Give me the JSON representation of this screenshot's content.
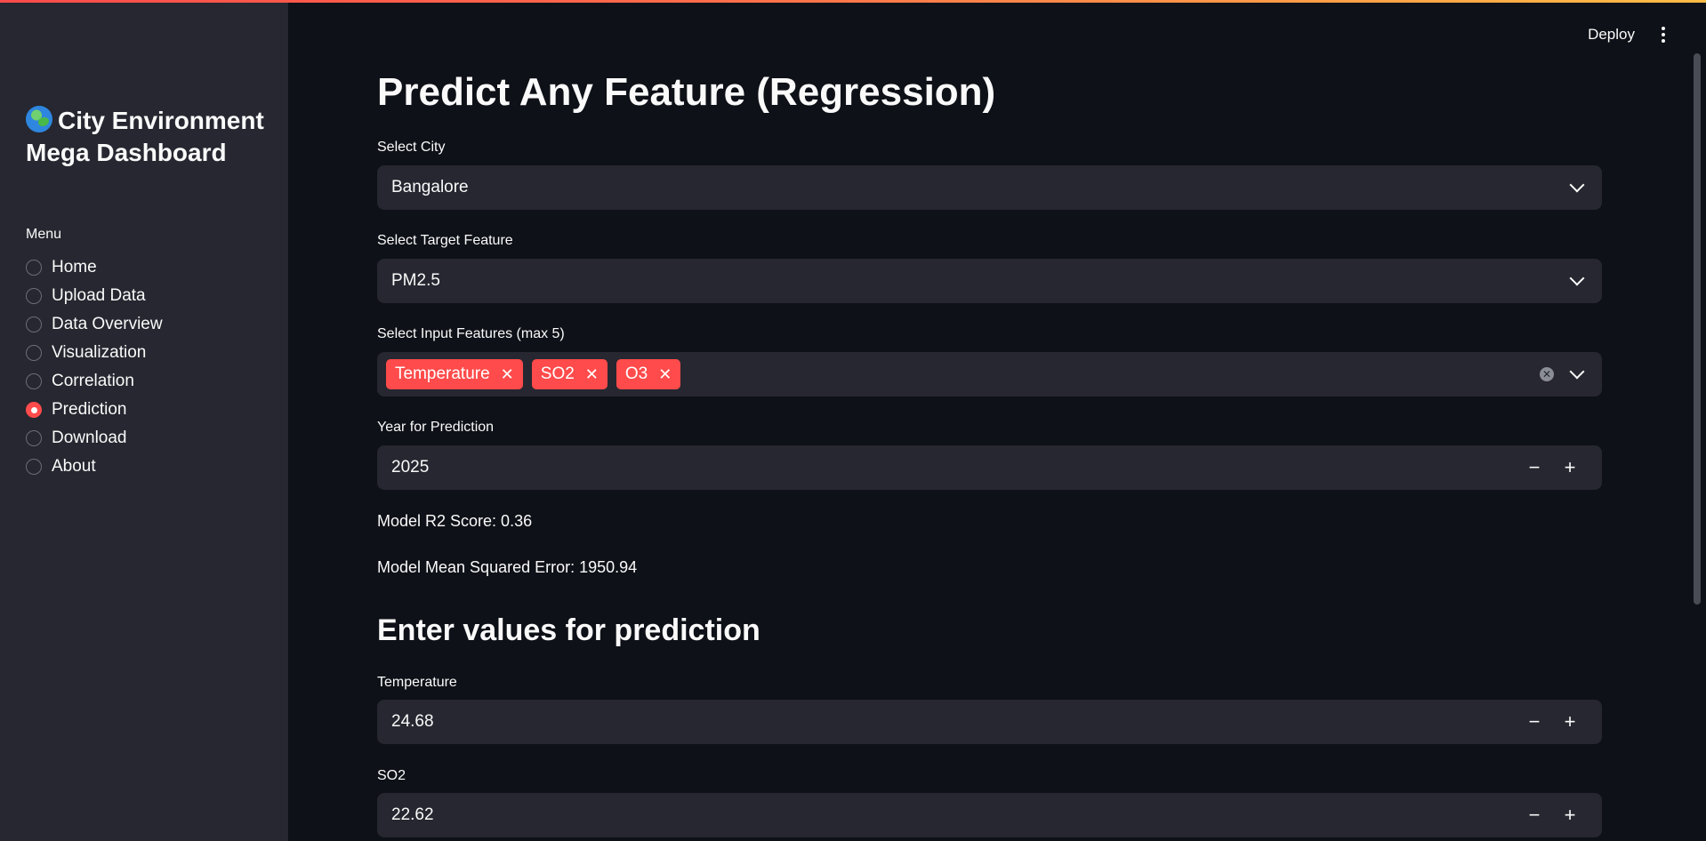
{
  "sidebar": {
    "title": "City Environment Mega Dashboard",
    "menu_label": "Menu",
    "items": [
      {
        "label": "Home",
        "selected": false
      },
      {
        "label": "Upload Data",
        "selected": false
      },
      {
        "label": "Data Overview",
        "selected": false
      },
      {
        "label": "Visualization",
        "selected": false
      },
      {
        "label": "Correlation",
        "selected": false
      },
      {
        "label": "Prediction",
        "selected": true
      },
      {
        "label": "Download",
        "selected": false
      },
      {
        "label": "About",
        "selected": false
      }
    ]
  },
  "header": {
    "deploy_label": "Deploy"
  },
  "main": {
    "title": "Predict Any Feature (Regression)",
    "city": {
      "label": "Select City",
      "value": "Bangalore"
    },
    "target": {
      "label": "Select Target Feature",
      "value": "PM2.5"
    },
    "inputs": {
      "label": "Select Input Features (max 5)",
      "tags": [
        "Temperature",
        "SO2",
        "O3"
      ]
    },
    "year": {
      "label": "Year for Prediction",
      "value": "2025"
    },
    "r2": "Model R2 Score: 0.36",
    "mse": "Model Mean Squared Error: 1950.94",
    "section_title": "Enter values for prediction",
    "temperature": {
      "label": "Temperature",
      "value": "24.68"
    },
    "so2": {
      "label": "SO2",
      "value": "22.62"
    }
  },
  "colors": {
    "accent": "#ff4b4b",
    "background": "#0e1117",
    "sidebar": "#262730"
  }
}
